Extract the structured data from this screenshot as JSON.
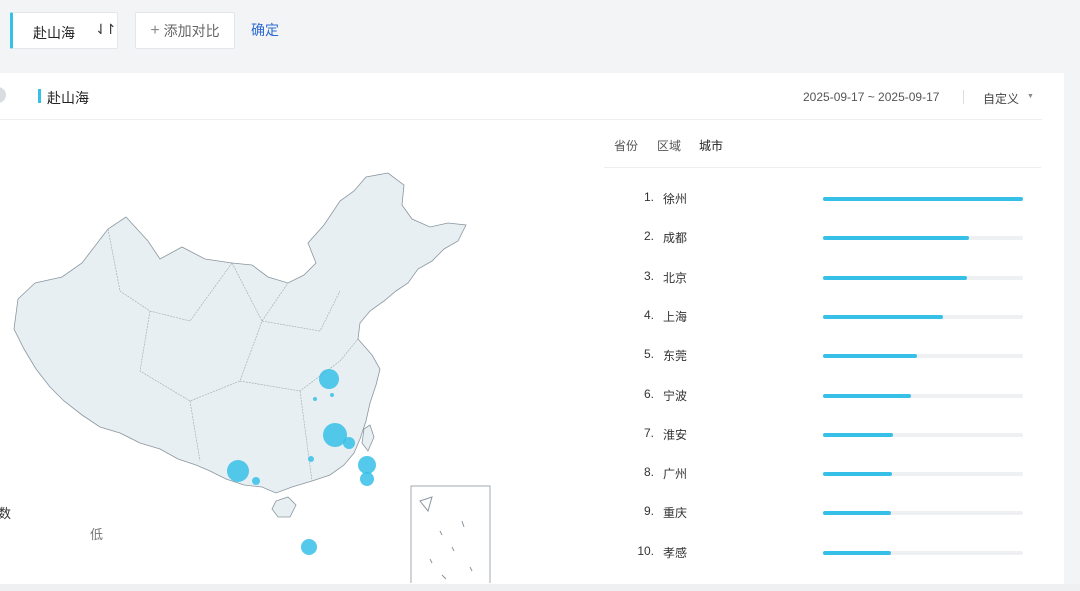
{
  "search": {
    "keyword": "赴山海",
    "sort_icon": "⇃↾",
    "add_compare_label": "添加对比",
    "confirm_label": "确定"
  },
  "panel": {
    "title": "赴山海",
    "date_range": "2025-09-17 ~ 2025-09-17",
    "custom_label": "自定义",
    "tabs": [
      "省份",
      "区域",
      "城市"
    ],
    "active_tab": "城市"
  },
  "ranking": [
    {
      "rank": "1.",
      "city": "徐州",
      "value": 1.0
    },
    {
      "rank": "2.",
      "city": "成都",
      "value": 0.73
    },
    {
      "rank": "3.",
      "city": "北京",
      "value": 0.72
    },
    {
      "rank": "4.",
      "city": "上海",
      "value": 0.6
    },
    {
      "rank": "5.",
      "city": "东莞",
      "value": 0.47
    },
    {
      "rank": "6.",
      "city": "宁波",
      "value": 0.44
    },
    {
      "rank": "7.",
      "city": "淮安",
      "value": 0.35
    },
    {
      "rank": "8.",
      "city": "广州",
      "value": 0.345
    },
    {
      "rank": "9.",
      "city": "重庆",
      "value": 0.34
    },
    {
      "rank": "10.",
      "city": "孝感",
      "value": 0.34
    }
  ],
  "legend": {
    "title": "数",
    "low_label": "低"
  },
  "colors": {
    "accent": "#36c0e8",
    "link": "#2d6bd3",
    "map_fill": "#e8eff2"
  }
}
